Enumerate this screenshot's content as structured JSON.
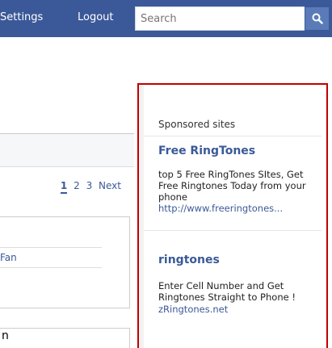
{
  "header": {
    "settings_label": "Settings",
    "logout_label": "Logout",
    "search_placeholder": "Search",
    "accent_color": "#3b5998"
  },
  "pager": {
    "pages": [
      "1",
      "2",
      "3"
    ],
    "current_page": "1",
    "next_label": "Next"
  },
  "left_card": {
    "fan_text": "Fan"
  },
  "stray_text": "n",
  "sponsored": {
    "title": "Sponsored sites",
    "border_color": "#c10000",
    "ads": [
      {
        "title": "Free RingTones",
        "description": "top 5 Free RingTones SItes, Get Free Ringtones Today from your phone",
        "url": "http://www.freeringtones..."
      },
      {
        "title": "ringtones",
        "description": "Enter Cell Number and Get Ringtones Straight to Phone !",
        "url": "zRingtones.net"
      }
    ]
  }
}
